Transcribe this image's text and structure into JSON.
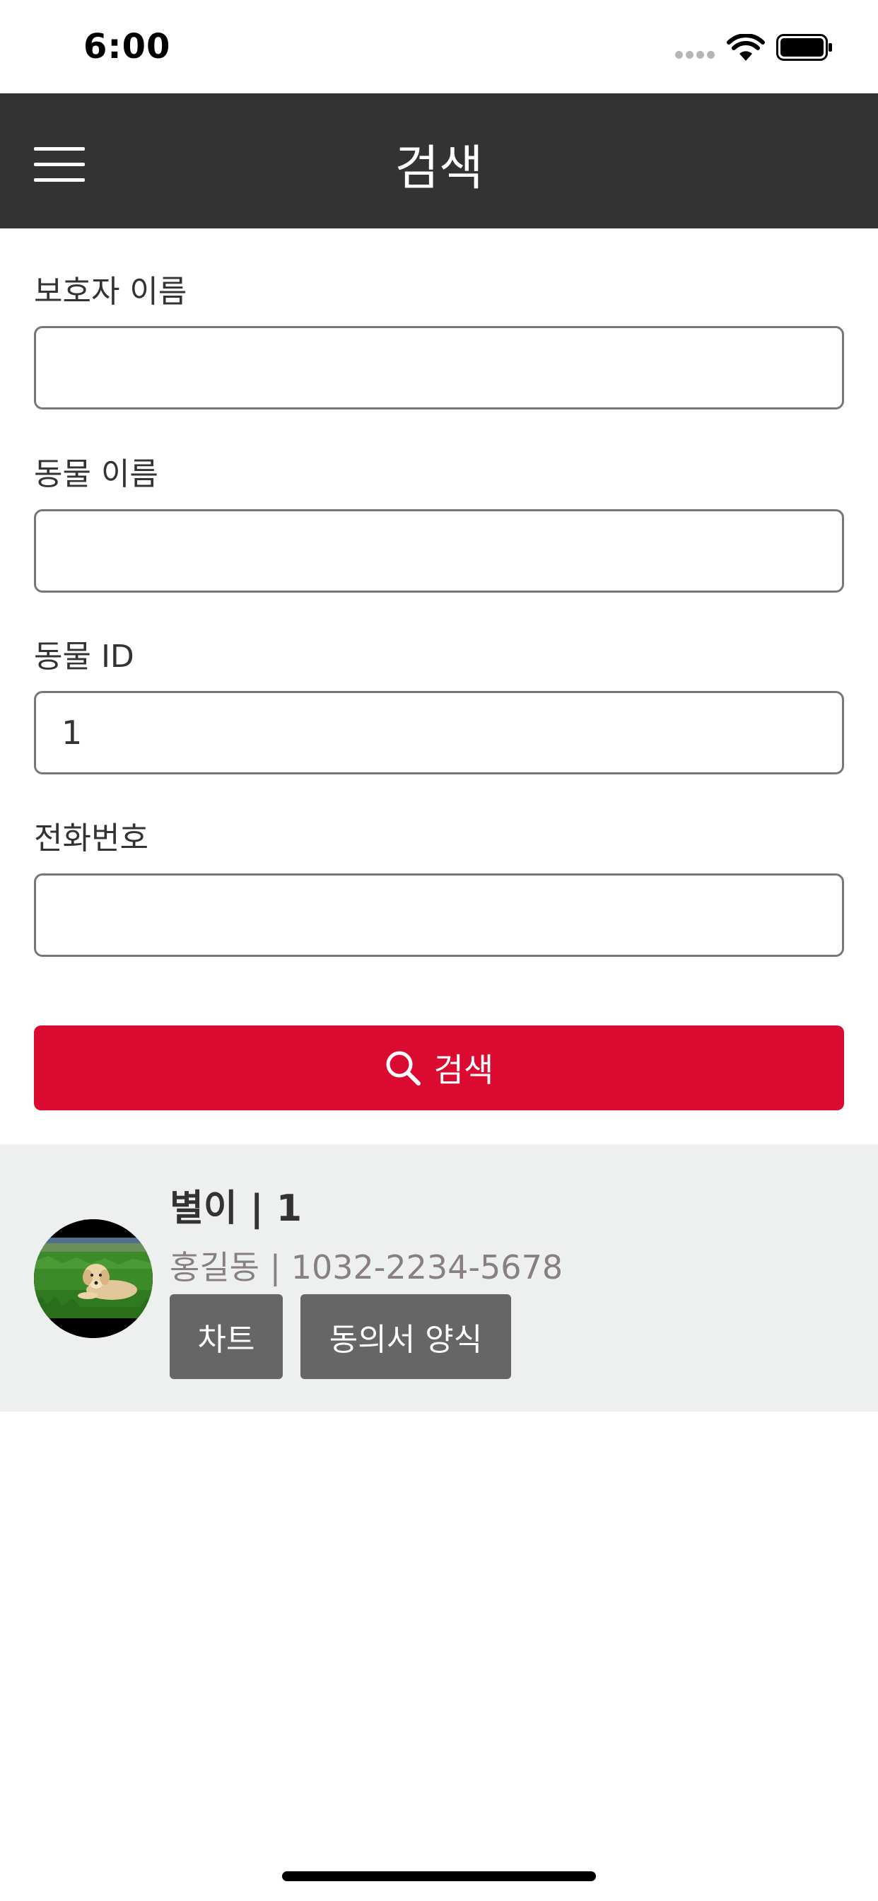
{
  "status_bar": {
    "time": "6:00"
  },
  "header": {
    "title": "검색",
    "menu_icon": "hamburger-menu-icon"
  },
  "form": {
    "guardian_name": {
      "label": "보호자 이름",
      "value": ""
    },
    "animal_name": {
      "label": "동물 이름",
      "value": ""
    },
    "animal_id": {
      "label": "동물 ID",
      "value": "1"
    },
    "phone": {
      "label": "전화번호",
      "value": ""
    },
    "search_button": {
      "label": "검색",
      "icon": "search-icon"
    }
  },
  "results": [
    {
      "title": "별이 | 1",
      "subtitle": "홍길동 | 1032-2234-5678",
      "chart_button": "차트",
      "consent_button": "동의서 양식"
    }
  ],
  "colors": {
    "header_bg": "#333333",
    "accent": "#db0a30",
    "result_bg": "#eef0ef",
    "result_button_bg": "#666666"
  }
}
